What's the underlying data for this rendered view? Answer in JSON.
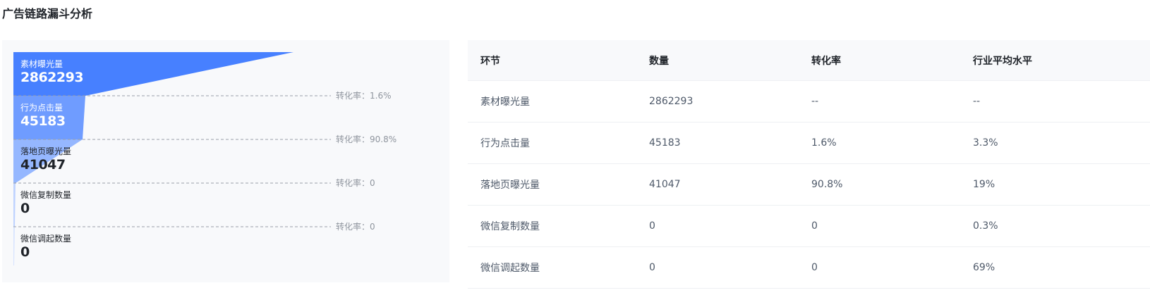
{
  "page": {
    "title": "广告链路漏斗分析"
  },
  "funnel": {
    "stages": [
      {
        "label": "素材曝光量",
        "value": "2862293"
      },
      {
        "label": "行为点击量",
        "value": "45183"
      },
      {
        "label": "落地页曝光量",
        "value": "41047"
      },
      {
        "label": "微信复制数量",
        "value": "0"
      },
      {
        "label": "微信调起数量",
        "value": "0"
      }
    ],
    "conversions": [
      "转化率：1.6%",
      "转化率：90.8%",
      "转化率：0",
      "转化率：0"
    ],
    "colors": {
      "stage1": "#4780ff",
      "stage2": "#6f9cff",
      "stage3": "#95b7ff",
      "stage4": "#bfd3ff",
      "stage5": "#d8e4ff"
    }
  },
  "table": {
    "headers": [
      "环节",
      "数量",
      "转化率",
      "行业平均水平"
    ],
    "rows": [
      [
        "素材曝光量",
        "2862293",
        "--",
        "--"
      ],
      [
        "行为点击量",
        "45183",
        "1.6%",
        "3.3%"
      ],
      [
        "落地页曝光量",
        "41047",
        "90.8%",
        "19%"
      ],
      [
        "微信复制数量",
        "0",
        "0",
        "0.3%"
      ],
      [
        "微信调起数量",
        "0",
        "0",
        "69%"
      ]
    ]
  }
}
